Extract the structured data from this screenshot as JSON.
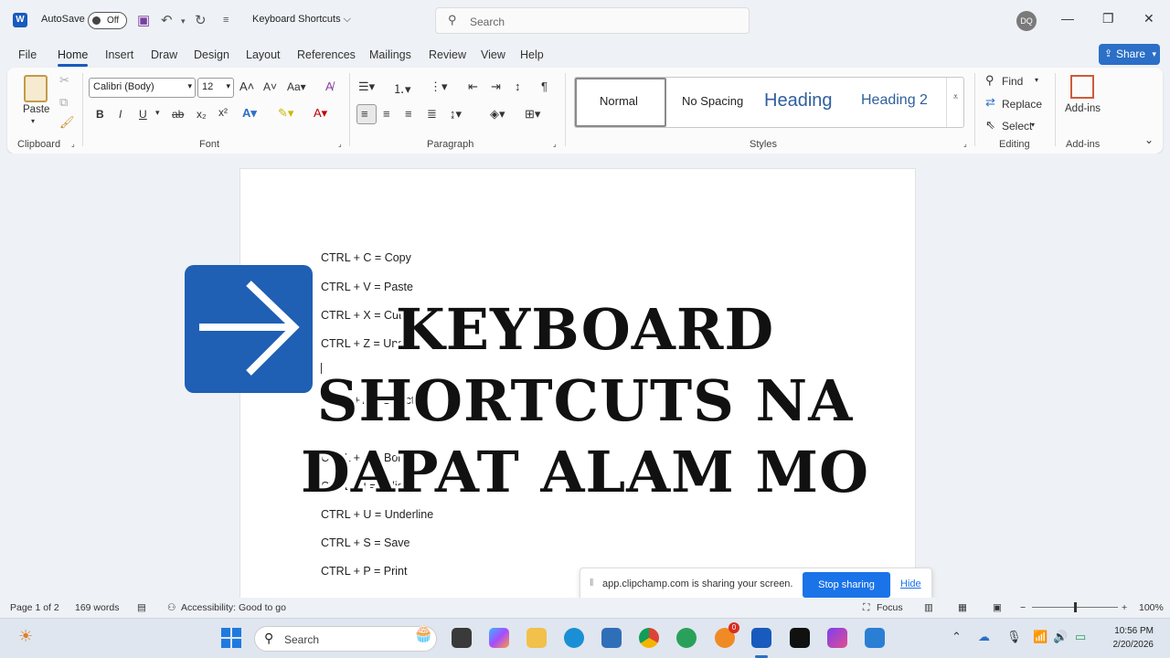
{
  "titlebar": {
    "autosave_label": "AutoSave",
    "autosave_state": "Off",
    "doc_title": "Keyboard Shortcuts ⌵",
    "search_placeholder": "Search",
    "avatar_initials": "DQ"
  },
  "menu": {
    "tabs": [
      "File",
      "Home",
      "Insert",
      "Draw",
      "Design",
      "Layout",
      "References",
      "Mailings",
      "Review",
      "View",
      "Help"
    ],
    "active_tab": "Home",
    "share_label": "Share"
  },
  "ribbon": {
    "clipboard": {
      "label": "Clipboard",
      "paste": "Paste"
    },
    "font": {
      "label": "Font",
      "font_name": "Calibri (Body)",
      "font_size": "12"
    },
    "paragraph": {
      "label": "Paragraph"
    },
    "styles": {
      "label": "Styles",
      "items": [
        "Normal",
        "No Spacing",
        "Heading",
        "Heading 2"
      ]
    },
    "editing": {
      "label": "Editing",
      "find": "Find",
      "replace": "Replace",
      "select": "Select"
    },
    "addins": {
      "label": "Add-ins",
      "button": "Add-ins"
    }
  },
  "document": {
    "lines": [
      "CTRL + C = Copy",
      "CTRL + V = Paste",
      "CTRL + X = Cut",
      "CTRL + Z = Undo",
      "CTRL + A = Select All",
      "CTRL + B = Bold",
      "CTRL + I = Italic",
      "CTRL + U = Underline",
      "CTRL + S = Save",
      "CTRL + P = Print"
    ]
  },
  "overlay": {
    "headline_lines": [
      "KEYBOARD",
      "SHORTCUTS NA",
      "DAPAT ALAM MO"
    ]
  },
  "share_notice": {
    "message": "app.clipchamp.com is sharing your screen.",
    "stop_label": "Stop sharing",
    "hide_label": "Hide"
  },
  "statusbar": {
    "page": "Page 1 of 2",
    "words": "169 words",
    "accessibility": "Accessibility: Good to go",
    "focus": "Focus",
    "zoom": "100%"
  },
  "taskbar": {
    "search_placeholder": "Search",
    "time": "10:56 PM",
    "date": "2/20/2026",
    "badge_count": "0"
  }
}
